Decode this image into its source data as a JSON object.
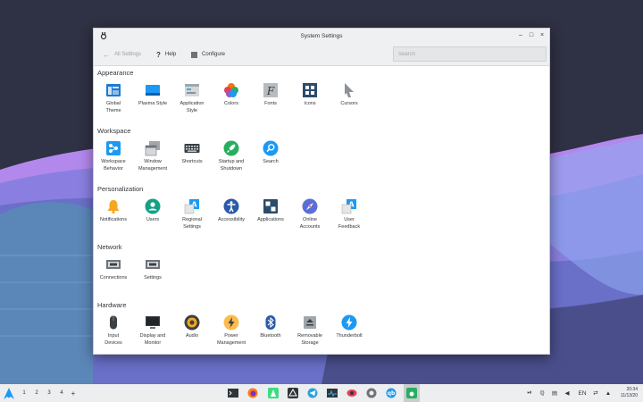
{
  "window": {
    "title": "System Settings",
    "controls": {
      "minimize": "–",
      "maximize": "□",
      "close": "×"
    }
  },
  "toolbar": {
    "back_label": "All Settings",
    "help_label": "Help",
    "configure_label": "Configure",
    "search_placeholder": "Search"
  },
  "sections": {
    "appearance": {
      "title": "Appearance",
      "items": [
        {
          "name": "global-theme",
          "label": [
            "Global",
            "Theme"
          ],
          "icon": "global-theme-icon"
        },
        {
          "name": "plasma-style",
          "label": [
            "Plasma Style"
          ],
          "icon": "plasma-style-icon"
        },
        {
          "name": "application-style",
          "label": [
            "Application",
            "Style"
          ],
          "icon": "application-style-icon"
        },
        {
          "name": "colors",
          "label": [
            "Colors"
          ],
          "icon": "colors-icon"
        },
        {
          "name": "fonts",
          "label": [
            "Fonts"
          ],
          "icon": "fonts-icon"
        },
        {
          "name": "icons",
          "label": [
            "Icons"
          ],
          "icon": "icons-icon"
        },
        {
          "name": "cursors",
          "label": [
            "Cursors"
          ],
          "icon": "cursors-icon"
        }
      ]
    },
    "workspace": {
      "title": "Workspace",
      "items": [
        {
          "name": "workspace-behavior",
          "label": [
            "Workspace",
            "Behavior"
          ],
          "icon": "workspace-behavior-icon"
        },
        {
          "name": "window-management",
          "label": [
            "Window",
            "Management"
          ],
          "icon": "window-management-icon"
        },
        {
          "name": "shortcuts",
          "label": [
            "Shortcuts"
          ],
          "icon": "keyboard-icon"
        },
        {
          "name": "startup-shutdown",
          "label": [
            "Startup and",
            "Shutdown"
          ],
          "icon": "rocket-icon"
        },
        {
          "name": "search",
          "label": [
            "Search"
          ],
          "icon": "search-icon"
        }
      ]
    },
    "personalization": {
      "title": "Personalization",
      "items": [
        {
          "name": "notifications",
          "label": [
            "Notifications"
          ],
          "icon": "bell-icon"
        },
        {
          "name": "users",
          "label": [
            "Users"
          ],
          "icon": "user-icon"
        },
        {
          "name": "regional-settings",
          "label": [
            "Regional",
            "Settings"
          ],
          "icon": "regional-icon"
        },
        {
          "name": "accessibility",
          "label": [
            "Accessibility"
          ],
          "icon": "accessibility-icon"
        },
        {
          "name": "applications",
          "label": [
            "Applications"
          ],
          "icon": "applications-icon"
        },
        {
          "name": "online-accounts",
          "label": [
            "Online",
            "Accounts"
          ],
          "icon": "online-accounts-icon"
        },
        {
          "name": "user-feedback",
          "label": [
            "User",
            "Feedback"
          ],
          "icon": "feedback-icon"
        }
      ]
    },
    "network": {
      "title": "Network",
      "items": [
        {
          "name": "connections",
          "label": [
            "Connections"
          ],
          "icon": "network-icon"
        },
        {
          "name": "network-settings",
          "label": [
            "Settings"
          ],
          "icon": "network-icon"
        }
      ]
    },
    "hardware": {
      "title": "Hardware",
      "items": [
        {
          "name": "input-devices",
          "label": [
            "Input",
            "Devices"
          ],
          "icon": "mouse-icon"
        },
        {
          "name": "display-monitor",
          "label": [
            "Display and",
            "Monitor"
          ],
          "icon": "monitor-icon"
        },
        {
          "name": "audio",
          "label": [
            "Audio"
          ],
          "icon": "speaker-icon"
        },
        {
          "name": "power-management",
          "label": [
            "Power",
            "Management"
          ],
          "icon": "power-icon"
        },
        {
          "name": "bluetooth",
          "label": [
            "Bluetooth"
          ],
          "icon": "bluetooth-icon"
        },
        {
          "name": "removable-storage",
          "label": [
            "Removable",
            "Storage"
          ],
          "icon": "storage-icon"
        },
        {
          "name": "thunderbolt",
          "label": [
            "Thunderbolt"
          ],
          "icon": "thunderbolt-icon"
        }
      ]
    }
  },
  "taskbar": {
    "desktops": [
      "1",
      "2",
      "3",
      "4"
    ],
    "add_desktop": "+",
    "keyboard_layout": "EN",
    "clock_time": "20:34",
    "clock_date": "11/13/20"
  },
  "colors": {
    "accent": "#3daee9",
    "text": "#31363b"
  }
}
